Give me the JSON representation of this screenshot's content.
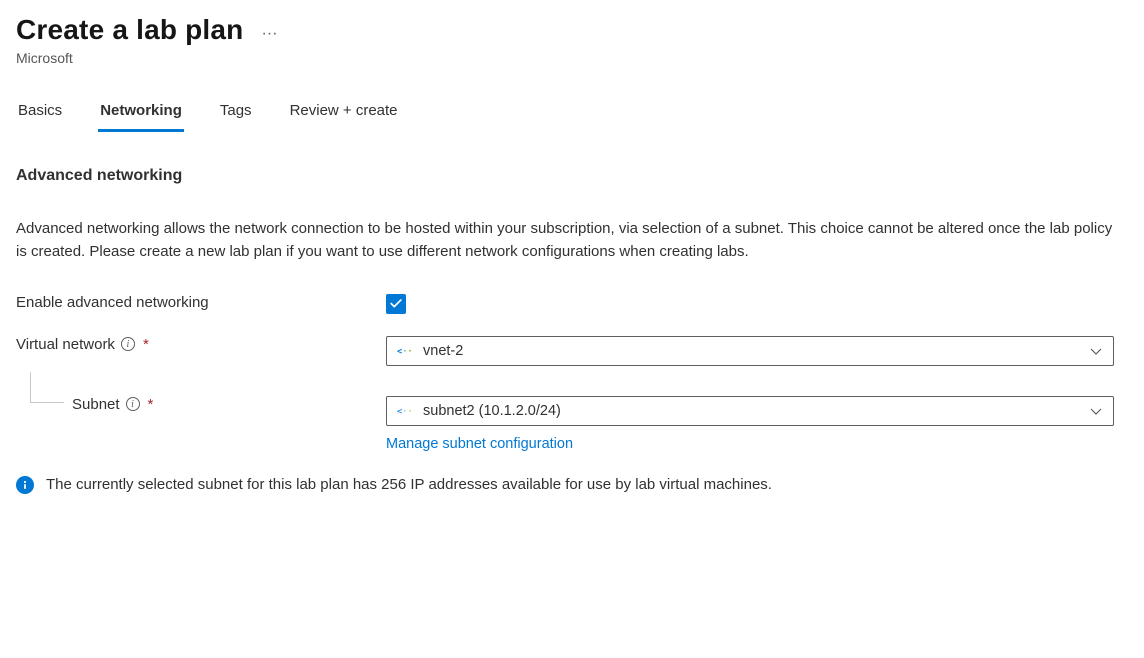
{
  "header": {
    "title": "Create a lab plan",
    "subtitle": "Microsoft"
  },
  "tabs": [
    {
      "label": "Basics"
    },
    {
      "label": "Networking"
    },
    {
      "label": "Tags"
    },
    {
      "label": "Review + create"
    }
  ],
  "active_tab_index": 1,
  "section": {
    "title": "Advanced networking",
    "description": "Advanced networking allows the network connection to be hosted within your subscription, via selection of a subnet. This choice cannot be altered once the lab policy is created. Please create a new lab plan if you want to use different network configurations when creating labs."
  },
  "fields": {
    "enable_label": "Enable advanced networking",
    "enable_checked": true,
    "vnet_label": "Virtual network",
    "vnet_value": "vnet-2",
    "subnet_label": "Subnet",
    "subnet_value": "subnet2 (10.1.2.0/24)",
    "manage_link": "Manage subnet configuration"
  },
  "info_message": "The currently selected subnet for this lab plan has 256 IP addresses available for use by lab virtual machines."
}
